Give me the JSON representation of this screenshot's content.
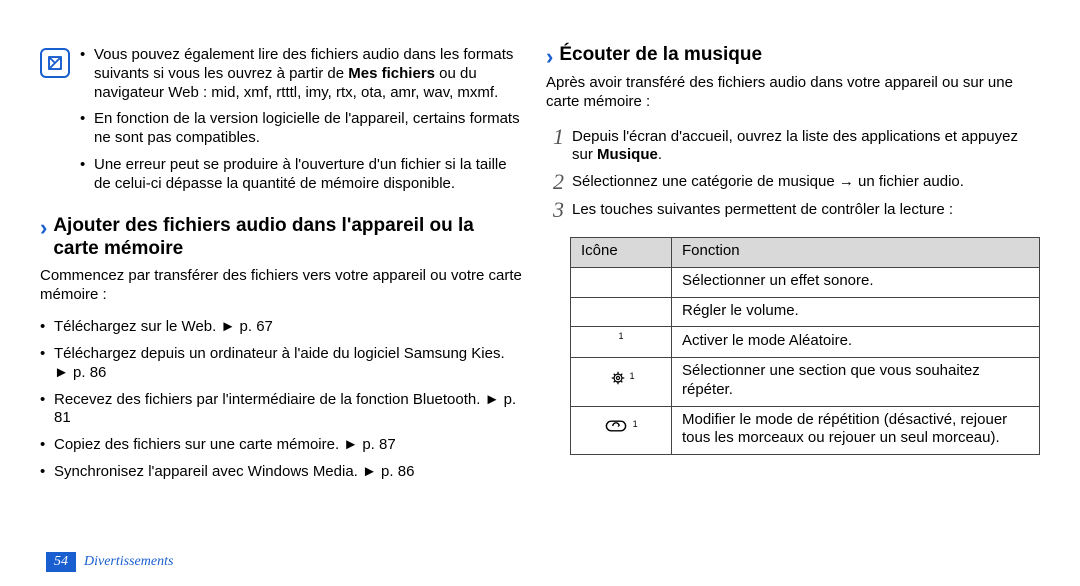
{
  "left": {
    "note": {
      "bullets": [
        {
          "pre": "Vous pouvez également lire des fichiers audio dans les formats suivants si vous les ouvrez à partir de ",
          "bold": "Mes fichiers",
          "post": " ou du navigateur Web : mid, xmf, rtttl, imy, rtx, ota, amr, wav, mxmf."
        },
        {
          "text": "En fonction de la version logicielle de l'appareil, certains formats ne sont pas compatibles."
        },
        {
          "text": "Une erreur peut se produire à l'ouverture d'un fichier si la taille de celui-ci dépasse la quantité de mémoire disponible."
        }
      ]
    },
    "section": {
      "title": "Ajouter des fichiers audio dans l'appareil ou la carte mémoire",
      "intro": "Commencez par transférer des fichiers vers votre appareil ou votre carte mémoire :",
      "bullets": [
        {
          "text": "Téléchargez sur le Web.",
          "ref": "p. 67"
        },
        {
          "text": "Téléchargez depuis un ordinateur à l'aide du logiciel Samsung Kies.",
          "ref": "p. 86"
        },
        {
          "text": "Recevez des fichiers par l'intermédiaire de la fonction Bluetooth.",
          "ref": "p. 81"
        },
        {
          "text": "Copiez des fichiers sur une carte mémoire.",
          "ref": "p. 87"
        },
        {
          "text": "Synchronisez l'appareil avec Windows Media.",
          "ref": "p. 86"
        }
      ]
    }
  },
  "right": {
    "section": {
      "title": "Écouter de la musique",
      "intro": "Après avoir transféré des fichiers audio dans votre appareil ou sur une carte mémoire :",
      "steps": [
        {
          "num": "1",
          "pre": "Depuis l'écran d'accueil, ouvrez la liste des applications et appuyez sur ",
          "bold": "Musique",
          "post": "."
        },
        {
          "num": "2",
          "text": "Sélectionnez une catégorie de musique → un fichier audio."
        },
        {
          "num": "3",
          "text": "Les touches suivantes permettent de contrôler la lecture :"
        }
      ],
      "table": {
        "head": {
          "icon": "Icône",
          "fn": "Fonction"
        },
        "rows": [
          {
            "icon": "",
            "sup": "",
            "fn": "Sélectionner un effet sonore."
          },
          {
            "icon": "",
            "sup": "",
            "fn": "Régler le volume."
          },
          {
            "icon": "",
            "sup": "1",
            "fn": "Activer le mode Aléatoire."
          },
          {
            "icon": "gear",
            "sup": "1",
            "fn": "Sélectionner une section que vous souhaitez répéter."
          },
          {
            "icon": "repeat",
            "sup": "1",
            "fn": "Modifier le mode de répétition (désactivé, rejouer tous les morceaux ou rejouer un seul morceau)."
          }
        ]
      }
    }
  },
  "footer": {
    "page": "54",
    "section": "Divertissements"
  },
  "ref_arrow": "►"
}
